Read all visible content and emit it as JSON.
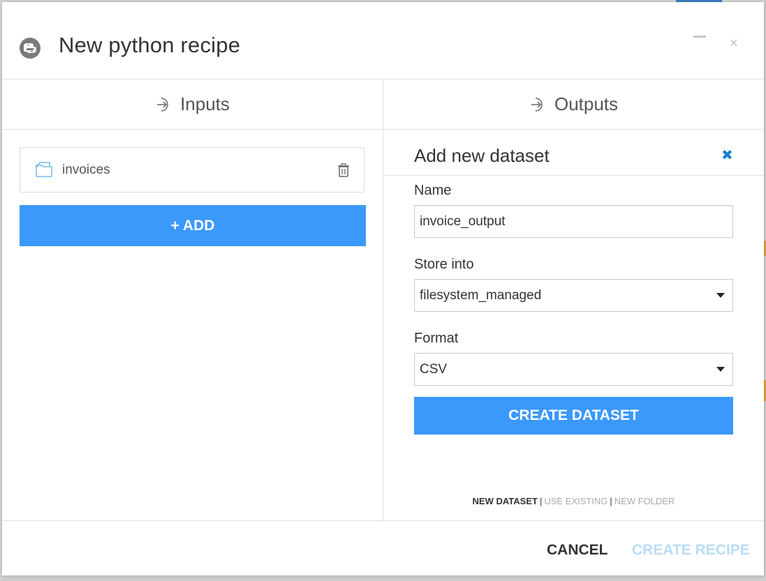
{
  "modal": {
    "title": "New python recipe",
    "close_symbol": "×"
  },
  "inputs": {
    "heading": "Inputs",
    "items": [
      {
        "label": "invoices",
        "icon": "dataset-folder-icon"
      }
    ],
    "add_label": "+ ADD"
  },
  "outputs": {
    "heading": "Outputs",
    "panel_title": "Add new dataset",
    "close_symbol": "✖",
    "name_label": "Name",
    "name_value": "invoice_output",
    "store_label": "Store into",
    "store_value": "filesystem_managed",
    "format_label": "Format",
    "format_value": "CSV",
    "create_label": "CREATE DATASET",
    "modes": {
      "new_dataset": "NEW DATASET",
      "use_existing": "USE EXISTING",
      "new_folder": "NEW FOLDER",
      "separator": "|"
    }
  },
  "footer": {
    "cancel": "CANCEL",
    "create_recipe": "CREATE RECIPE"
  },
  "colors": {
    "primary_button": "#3b99fc",
    "disabled_button_text": "#b8dcf8",
    "close_blue": "#1a7fd4"
  }
}
